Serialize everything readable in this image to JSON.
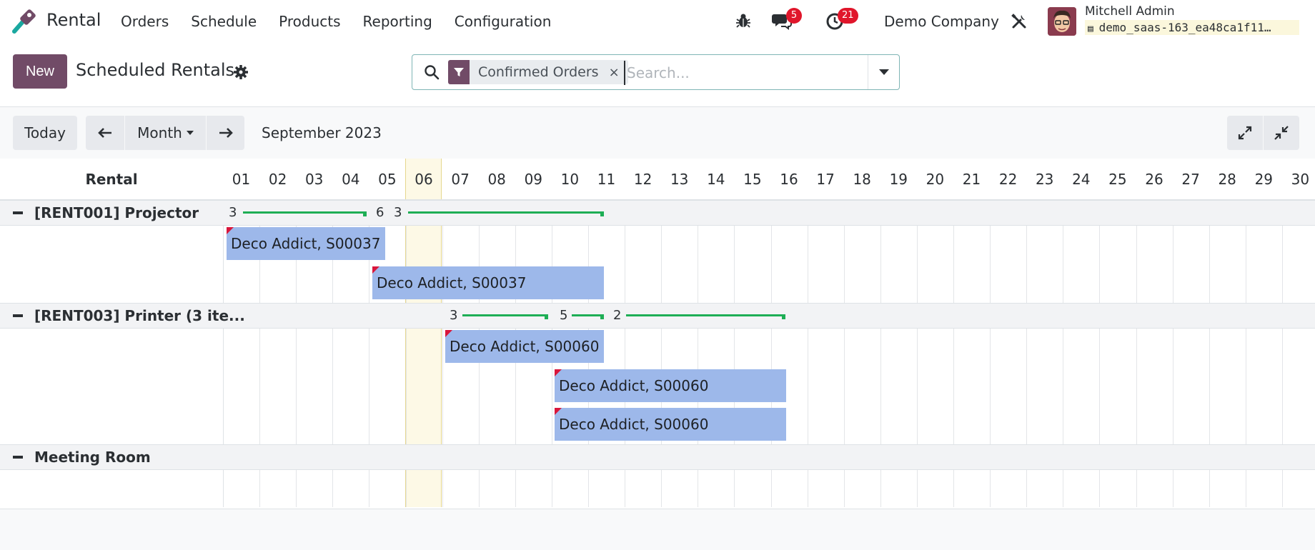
{
  "app": {
    "name": "Rental",
    "menu": [
      "Orders",
      "Schedule",
      "Products",
      "Reporting",
      "Configuration"
    ],
    "messages_count": "5",
    "activities_count": "21",
    "company": "Demo Company",
    "user_name": "Mitchell Admin",
    "database": "demo_saas-163_ea48ca1f11…"
  },
  "control": {
    "new_label": "New",
    "title": "Scheduled Rentals",
    "facet_label": "Confirmed Orders",
    "facet_close": "×",
    "search_placeholder": "Search..."
  },
  "toolbar": {
    "today_label": "Today",
    "scale_label": "Month",
    "period": "September 2023"
  },
  "gantt": {
    "row_header": "Rental",
    "days": [
      "01",
      "02",
      "03",
      "04",
      "05",
      "06",
      "07",
      "08",
      "09",
      "10",
      "11",
      "12",
      "13",
      "14",
      "15",
      "16",
      "17",
      "18",
      "19",
      "20",
      "21",
      "22",
      "23",
      "24",
      "25",
      "26",
      "27",
      "28",
      "29",
      "30"
    ],
    "today": "06",
    "groups": [
      {
        "label": "[RENT001] Projector",
        "availability": [
          "3",
          "6",
          "3"
        ],
        "pills": [
          "Deco Addict, S00037",
          "Deco Addict, S00037"
        ]
      },
      {
        "label": "[RENT003] Printer (3 ite...",
        "availability": [
          "3",
          "5",
          "2"
        ],
        "pills": [
          "Deco Addict, S00060",
          "Deco Addict, S00060",
          "Deco Addict, S00060"
        ]
      },
      {
        "label": "Meeting Room",
        "availability": [],
        "pills": []
      }
    ]
  },
  "colors": {
    "brand": "#714b67",
    "pill": "#9db8ea",
    "availability": "#1eae55",
    "badge": "#e0162b",
    "today_highlight": "#fdf9e6"
  }
}
